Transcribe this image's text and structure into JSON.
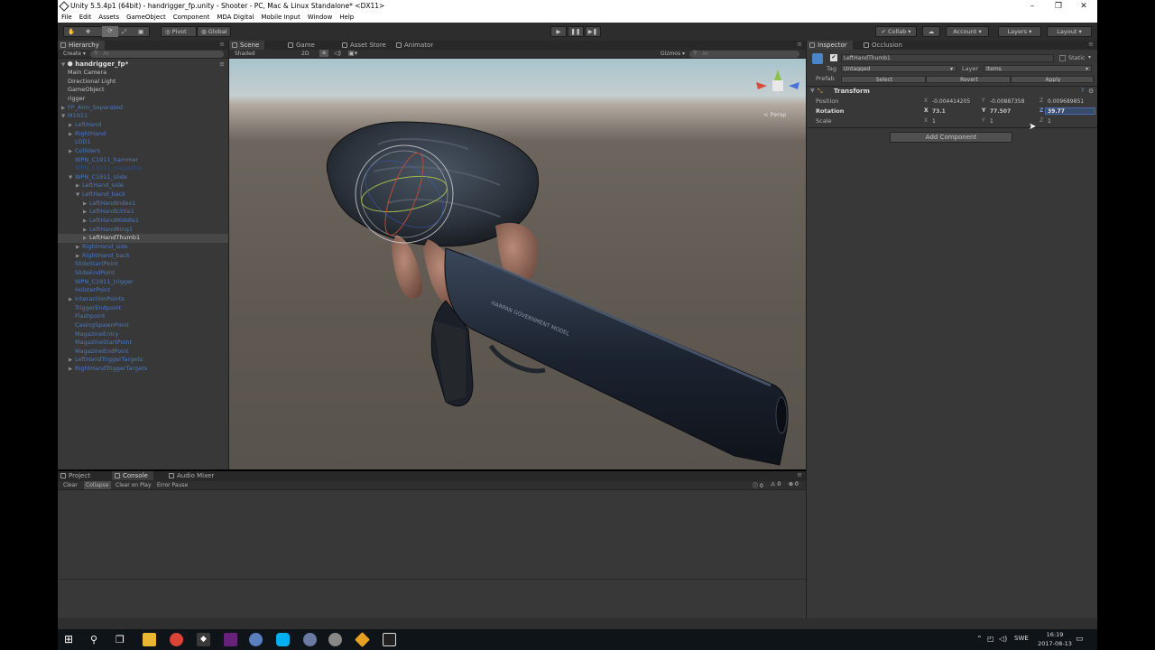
{
  "window": {
    "title": "Unity 5.5.4p1 (64bit) - handrigger_fp.unity - Shooter - PC, Mac & Linux Standalone* <DX11>"
  },
  "menu": [
    "File",
    "Edit",
    "Assets",
    "GameObject",
    "Component",
    "MDA Digital",
    "Mobile Input",
    "Window",
    "Help"
  ],
  "toolbar": {
    "pivot": "Pivot",
    "global": "Global",
    "collab": "Collab ▾",
    "account": "Account",
    "layers": "Layers",
    "layout": "Layout"
  },
  "hierarchy": {
    "tab": "Hierarchy",
    "create": "Create ▾",
    "search_placeholder": "All",
    "scene_name": "handrigger_fp*",
    "rows": [
      {
        "label": "Main Camera",
        "indent": 1,
        "arrow": "",
        "color": "white"
      },
      {
        "label": "Directional Light",
        "indent": 1,
        "arrow": "",
        "color": "white"
      },
      {
        "label": "GameObject",
        "indent": 1,
        "arrow": "",
        "color": "white"
      },
      {
        "label": "rigger",
        "indent": 1,
        "arrow": "",
        "color": "white"
      },
      {
        "label": "FP_Arm_Separated",
        "indent": 1,
        "arrow": "▶",
        "color": "blue"
      },
      {
        "label": "M1911",
        "indent": 1,
        "arrow": "▼",
        "color": "blue"
      },
      {
        "label": "LeftHand",
        "indent": 2,
        "arrow": "▶",
        "color": "blue"
      },
      {
        "label": "RightHand",
        "indent": 2,
        "arrow": "▶",
        "color": "blue"
      },
      {
        "label": "LOD1",
        "indent": 2,
        "arrow": "",
        "color": "blue"
      },
      {
        "label": "Colliders",
        "indent": 2,
        "arrow": "▶",
        "color": "blue"
      },
      {
        "label": "WPN_C1911_hammer",
        "indent": 2,
        "arrow": "",
        "color": "blue"
      },
      {
        "label": "WPN_C1911_magazine",
        "indent": 2,
        "arrow": "",
        "color": "dim"
      },
      {
        "label": "WPN_C1911_slide",
        "indent": 2,
        "arrow": "▼",
        "color": "blue"
      },
      {
        "label": "LeftHand_side",
        "indent": 3,
        "arrow": "▶",
        "color": "blue"
      },
      {
        "label": "LeftHand_back",
        "indent": 3,
        "arrow": "▼",
        "color": "blue"
      },
      {
        "label": "LeftHandIndex1",
        "indent": 4,
        "arrow": "▶",
        "color": "blue"
      },
      {
        "label": "LeftHandLittle1",
        "indent": 4,
        "arrow": "▶",
        "color": "blue"
      },
      {
        "label": "LeftHandMiddle1",
        "indent": 4,
        "arrow": "▶",
        "color": "blue"
      },
      {
        "label": "LeftHandRing1",
        "indent": 4,
        "arrow": "▶",
        "color": "blue"
      },
      {
        "label": "LeftHandThumb1",
        "indent": 4,
        "arrow": "▶",
        "color": "sel"
      },
      {
        "label": "RightHand_side",
        "indent": 3,
        "arrow": "▶",
        "color": "blue"
      },
      {
        "label": "RightHand_back",
        "indent": 3,
        "arrow": "▶",
        "color": "blue"
      },
      {
        "label": "SlideStartPoint",
        "indent": 2,
        "arrow": "",
        "color": "blue"
      },
      {
        "label": "SlideEndPoint",
        "indent": 2,
        "arrow": "",
        "color": "blue"
      },
      {
        "label": "WPN_C1911_trigger",
        "indent": 2,
        "arrow": "",
        "color": "blue"
      },
      {
        "label": "HolsterPoint",
        "indent": 2,
        "arrow": "",
        "color": "blue"
      },
      {
        "label": "InteractionPoints",
        "indent": 2,
        "arrow": "▶",
        "color": "blue"
      },
      {
        "label": "TriggerEndpoint",
        "indent": 2,
        "arrow": "",
        "color": "blue"
      },
      {
        "label": "Flashpoint",
        "indent": 2,
        "arrow": "",
        "color": "blue"
      },
      {
        "label": "CasingSpawnPoint",
        "indent": 2,
        "arrow": "",
        "color": "blue"
      },
      {
        "label": "MagazineEntry",
        "indent": 2,
        "arrow": "",
        "color": "blue"
      },
      {
        "label": "MagazineStartPoint",
        "indent": 2,
        "arrow": "",
        "color": "blue"
      },
      {
        "label": "MagazineEndPoint",
        "indent": 2,
        "arrow": "",
        "color": "blue"
      },
      {
        "label": "LeftHandTriggerTargets",
        "indent": 2,
        "arrow": "▶",
        "color": "blue"
      },
      {
        "label": "RightHandTriggerTargets",
        "indent": 2,
        "arrow": "▶",
        "color": "blue"
      }
    ]
  },
  "center_tabs": {
    "scene": "Scene",
    "game": "Game",
    "asset_store": "Asset Store",
    "animator": "Animator"
  },
  "scene_toolbar": {
    "shading": "Shaded",
    "mode2d": "2D",
    "gizmos": "Gizmos ▾",
    "search_placeholder": "All",
    "persp": "< Persp",
    "slide_text": "HARPAN GOVERNMENT MODEL"
  },
  "inspector": {
    "tab": "Inspector",
    "tab2": "Occlusion",
    "object_name": "LeftHandThumb1",
    "static": "Static",
    "tag_label": "Tag",
    "tag_value": "Untagged",
    "layer_label": "Layer",
    "layer_value": "Items",
    "prefab_label": "Prefab",
    "prefab_select": "Select",
    "prefab_revert": "Revert",
    "prefab_apply": "Apply",
    "component": "Transform",
    "position_label": "Position",
    "rotation_label": "Rotation",
    "scale_label": "Scale",
    "position": {
      "x": "-0.004414205",
      "y": "-0.00887358",
      "z": "0.009689851"
    },
    "rotation": {
      "x": "73.1",
      "y": "77.507",
      "z": "39.77"
    },
    "scale": {
      "x": "1",
      "y": "1",
      "z": "1"
    },
    "add_component": "Add Component"
  },
  "bottom_tabs": {
    "project": "Project",
    "console": "Console",
    "audio_mixer": "Audio Mixer"
  },
  "console_bar": {
    "clear": "Clear",
    "collapse": "Collapse",
    "clear_on_play": "Clear on Play",
    "error_pause": "Error Pause",
    "info_count": "0",
    "warn_count": "0",
    "error_count": "0"
  },
  "taskbar": {
    "lang": "SWE",
    "time": "16:19",
    "date": "2017-08-13"
  }
}
